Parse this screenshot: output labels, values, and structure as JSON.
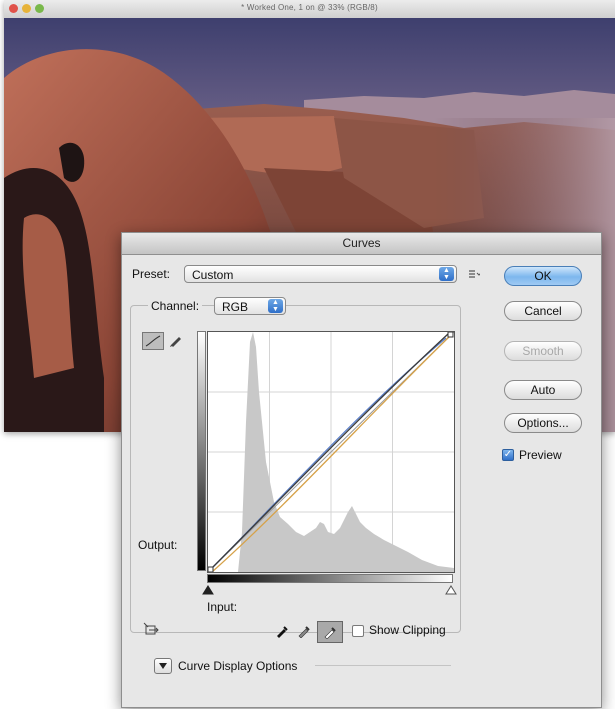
{
  "document": {
    "title": "* Worked One, 1 on @ 33% (RGB/8)"
  },
  "dialog": {
    "title": "Curves",
    "preset_label": "Preset:",
    "preset_value": "Custom",
    "channel_label": "Channel:",
    "channel_value": "RGB",
    "output_label": "Output:",
    "input_label": "Input:",
    "show_clipping_label": "Show Clipping",
    "show_clipping_checked": false,
    "curve_display_options_label": "Curve Display Options",
    "buttons": {
      "ok": "OK",
      "cancel": "Cancel",
      "smooth": "Smooth",
      "auto": "Auto",
      "options": "Options..."
    },
    "preview_label": "Preview",
    "preview_checked": true
  },
  "colors": {
    "accent_blue": "#2f6fc9",
    "histogram_gray": "#c8c8c8",
    "rgb_curve": "#3a3a3a",
    "blue_curve": "#5b7fc8",
    "orange_curve": "#d6a24a"
  }
}
